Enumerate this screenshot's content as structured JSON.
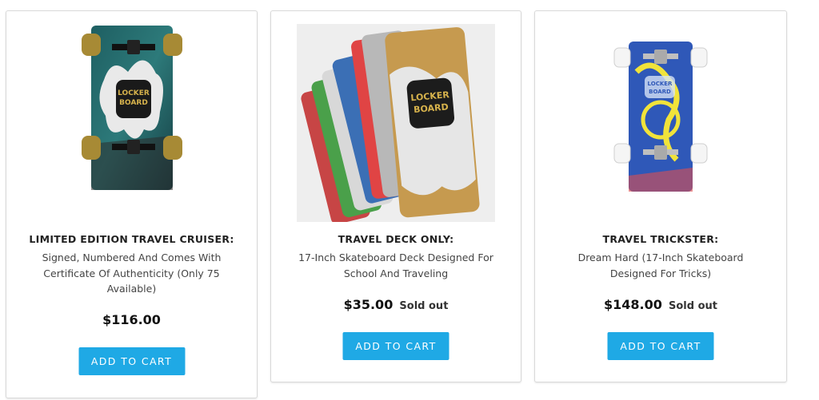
{
  "products": [
    {
      "title": "LIMITED EDITION TRAVEL CRUISER:",
      "description": "Signed, Numbered And Comes With Certificate Of Authenticity (Only 75 Available)",
      "price": "$116.00",
      "availability": "",
      "button_label": "ADD TO CART",
      "image_text": [
        "LOCKER",
        "BOARD"
      ]
    },
    {
      "title": "TRAVEL DECK ONLY:",
      "description": "17-Inch Skateboard Deck Designed For School And Traveling",
      "price": "$35.00",
      "availability": "Sold out",
      "button_label": "ADD TO CART",
      "image_text": [
        "LOCKER",
        "BOARD"
      ]
    },
    {
      "title": "TRAVEL TRICKSTER:",
      "description": "Dream Hard (17-Inch Skateboard Designed For Tricks)",
      "price": "$148.00",
      "availability": "Sold out",
      "button_label": "ADD TO CART",
      "image_text": [
        "LOCKER",
        "BOARD"
      ]
    }
  ],
  "colors": {
    "button": "#1fa9e5",
    "card_border": "#d9d9d9"
  }
}
